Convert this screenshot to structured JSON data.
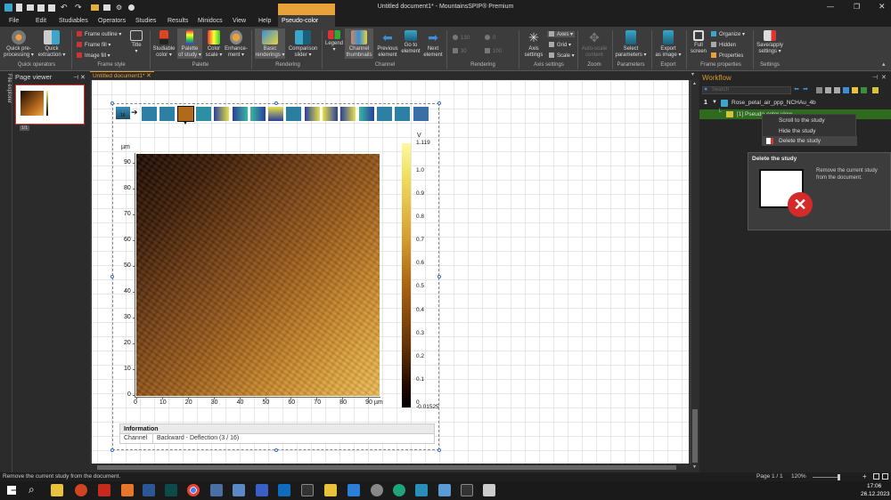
{
  "window": {
    "title": "Untitled document1* - MountainsSPIP® Premium"
  },
  "menu": [
    "File",
    "Edit",
    "Studiables",
    "Operators",
    "Studies",
    "Results",
    "Minidocs",
    "View",
    "Help",
    "Pseudo-color view"
  ],
  "ribbon": {
    "groups": {
      "quick_operators": "Quick operators",
      "frame_style": "Frame style",
      "palette": "Palette",
      "rendering1": "Rendering",
      "channel": "Channel",
      "rendering2": "Rendering",
      "axis_settings": "Axis settings",
      "zoom": "Zoom",
      "parameters": "Parameters",
      "export": "Export",
      "frame_properties": "Frame properties",
      "settings": "Settings"
    },
    "quick_preprocessing": "Quick pre-\nprocessing ▾",
    "quick_extraction": "Quick\nextraction ▾",
    "frame_outline": "Frame outline ▾",
    "frame_fill": "Frame fill ▾",
    "image_fill": "Image fill ▾",
    "title": "Title\n▾",
    "studiable_color": "Studiable\ncolor ▾",
    "palette_of_study": "Palette\nof study ▾",
    "color_scale": "Color\nscale ▾",
    "enhancement": "Enhance-\nment ▾",
    "basic_renderings": "Basic\nrenderings ▾",
    "comparison_slider": "Comparison\nslider ▾",
    "legend": "Legend\n▾",
    "channel_thumbnails": "Channel\nthumbnails",
    "previous_element": "Previous\nelement",
    "go_to_element": "Go to\nelement",
    "next_element": "Next\nelement",
    "render_val1": "130",
    "render_val2": "0",
    "render_val3": "30",
    "render_val4": "100",
    "axis_settings_btn": "Axis\nsettings",
    "axes": "Axes ▾",
    "grid": "Grid ▾",
    "scale": "Scale ▾",
    "auto_scale": "Auto-scale\ncontent",
    "select_parameters": "Select\nparameters ▾",
    "export_as_image": "Export\nas image ▾",
    "full_screen": "Full\nscreen",
    "organize": "Organize ▾",
    "hidden": "Hidden",
    "properties": "Properties",
    "save_apply_settings": "Save/apply\nsettings ▾"
  },
  "side": {
    "file_explorer": "File explorer",
    "page_viewer": "Page viewer",
    "thumb_page_num": "1/1"
  },
  "doc_tab": "Untitled document1*",
  "plot": {
    "unit_y": "µm",
    "unit_x": "µm",
    "unit_v": "V",
    "channel_counter": "16",
    "y_ticks": [
      "90",
      "80",
      "70",
      "60",
      "50",
      "40",
      "30",
      "20",
      "10",
      "0"
    ],
    "x_ticks": [
      "0",
      "10",
      "20",
      "30",
      "40",
      "50",
      "60",
      "70",
      "80",
      "90 µm"
    ],
    "scale_ticks": [
      "1.119",
      "1.0",
      "0.9",
      "0.8",
      "0.7",
      "0.6",
      "0.5",
      "0.4",
      "0.3",
      "0.2",
      "0.1",
      "0",
      "-0.01525"
    ]
  },
  "info": {
    "header": "Information",
    "channel_label": "Channel",
    "channel_value": "Backward - Deflection (3 / 16)"
  },
  "workflow": {
    "title": "Workflow",
    "search_placeholder": "Search",
    "item_num": "1",
    "item_name": "Rose_petal_air_ppp_NCHAu_4b",
    "study_name": "[1] Pseudo-color view"
  },
  "context_menu": [
    "Scroll to the study",
    "Hide the study",
    "Delete the study"
  ],
  "tooltip": {
    "title": "Delete the study",
    "text": "Remove the current study from the document."
  },
  "status": {
    "message": "Remove the current study from the document.",
    "page": "Page 1 / 1",
    "zoom": "120%"
  },
  "taskbar": {
    "time": "17:06",
    "date": "26.12.2023"
  },
  "colors": {
    "accent_orange": "#e8a23a",
    "selection_green": "#2e6b1f",
    "workflow_title": "#d99a2b"
  }
}
